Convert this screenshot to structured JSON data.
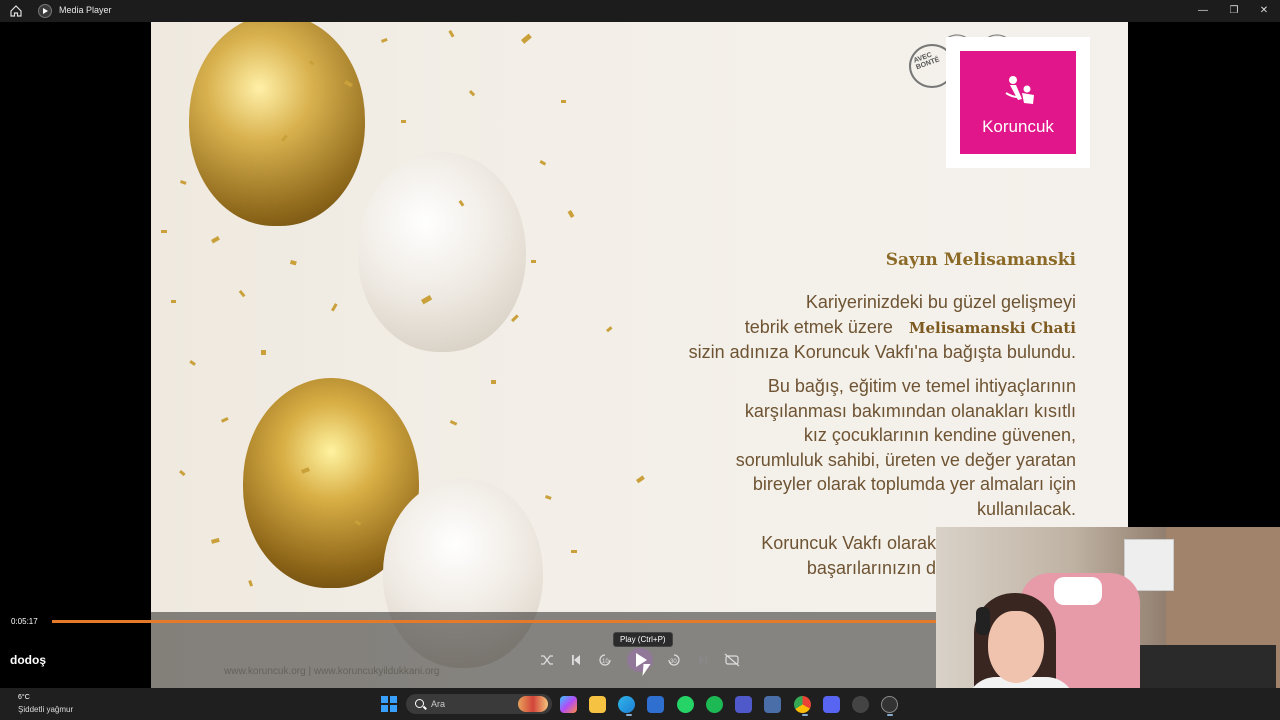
{
  "window": {
    "title": "Media Player",
    "controls": [
      "minimize",
      "maximize",
      "close"
    ]
  },
  "video": {
    "stamp_label": "Koruncuk",
    "postmark_text": "AVEC BONTÉ",
    "greeting": "Sayın Melisamanski",
    "paragraph1": {
      "line1": "Kariyerinizdeki bu güzel gelişmeyi",
      "line2_prefix": "tebrik etmek üzere",
      "line2_name": "Melisamanski Chati",
      "line3": "sizin adınıza Koruncuk Vakfı'na bağışta bulundu."
    },
    "paragraph2": [
      "Bu bağış, eğitim ve temel ihtiyaçlarının",
      "karşılanması bakımından olanakları kısıtlı",
      "kız çocuklarının kendine güvenen,",
      "sorumluluk sahibi, üreten ve değer yaratan",
      "bireyler olarak toplumda yer almaları için",
      "kullanılacak."
    ],
    "paragraph3": [
      "Koruncuk Vakfı olarak",
      "başarılarınızın d"
    ],
    "footer": "www.koruncuk.org   |   www.koruncukyildukkani.org"
  },
  "player": {
    "elapsed": "0:05:17",
    "progress_percent": 73,
    "media_title": "dodoş",
    "tooltip": "Play (Ctrl+P)",
    "buttons": {
      "shuffle": "shuffle",
      "previous": "previous",
      "rewind": "10",
      "play": "play",
      "forward": "30",
      "next": "next",
      "repeat": "repeat-off"
    }
  },
  "taskbar": {
    "weather_temp": "6°C",
    "weather_desc": "Şiddetli yağmur",
    "search_placeholder": "Ara",
    "apps": [
      "copilot",
      "file-explorer",
      "edge",
      "store",
      "whatsapp",
      "spotify",
      "teams",
      "vpn",
      "chrome",
      "discord",
      "obs",
      "media-player"
    ]
  },
  "colors": {
    "accent_progress": "#e67a2b",
    "stamp_pink": "#e0168a",
    "gold_text": "#8b6a27"
  }
}
